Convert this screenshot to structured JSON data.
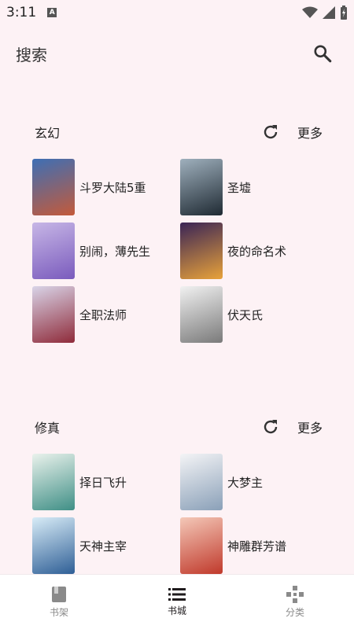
{
  "status": {
    "time": "3:11",
    "notification_badge": "A"
  },
  "search": {
    "title": "搜索"
  },
  "sections": [
    {
      "title": "玄幻",
      "more_label": "更多",
      "books": [
        {
          "title": "斗罗大陆5重",
          "cover_colors": [
            "#3d6fb5",
            "#c45a3a"
          ]
        },
        {
          "title": "圣墟",
          "cover_colors": [
            "#9fb0bd",
            "#1f2a33"
          ]
        },
        {
          "title": "别闹，薄先生",
          "cover_colors": [
            "#c7b6e6",
            "#7a5bbd"
          ]
        },
        {
          "title": "夜的命名术",
          "cover_colors": [
            "#3a2456",
            "#e8a23a"
          ]
        },
        {
          "title": "全职法师",
          "cover_colors": [
            "#d9d4e8",
            "#8f2b3a"
          ]
        },
        {
          "title": "伏天氏",
          "cover_colors": [
            "#f1f1f1",
            "#7a7a7a"
          ]
        }
      ]
    },
    {
      "title": "修真",
      "more_label": "更多",
      "books": [
        {
          "title": "择日飞升",
          "cover_colors": [
            "#eaf2ec",
            "#3f8f86"
          ]
        },
        {
          "title": "大梦主",
          "cover_colors": [
            "#f4f4f6",
            "#8aa0b8"
          ]
        },
        {
          "title": "天神主宰",
          "cover_colors": [
            "#d8ecf7",
            "#2f5f96"
          ]
        },
        {
          "title": "神雕群芳谱",
          "cover_colors": [
            "#f4c8b8",
            "#c0392b"
          ]
        }
      ]
    }
  ],
  "bottom_nav": [
    {
      "label": "书架",
      "icon": "book-icon",
      "active": false
    },
    {
      "label": "书城",
      "icon": "list-icon",
      "active": true
    },
    {
      "label": "分类",
      "icon": "gamepad-icon",
      "active": false
    }
  ]
}
